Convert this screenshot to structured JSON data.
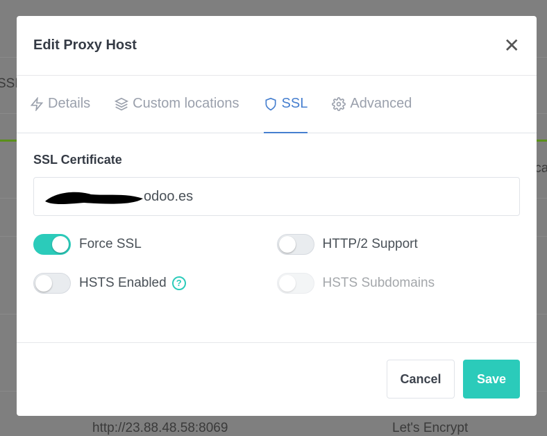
{
  "background": {
    "left_text": "SSL",
    "right_text": "lca",
    "bottom_url": "http://23.88.48.58:8069",
    "bottom_cert": "Let's Encrypt"
  },
  "modal": {
    "title": "Edit Proxy Host",
    "close_icon": "close-icon"
  },
  "tabs": [
    {
      "label": "Details",
      "icon": "bolt-icon"
    },
    {
      "label": "Custom locations",
      "icon": "layers-icon"
    },
    {
      "label": "SSL",
      "icon": "shield-icon",
      "active": true
    },
    {
      "label": "Advanced",
      "icon": "gear-icon"
    }
  ],
  "ssl": {
    "certificate_label": "SSL Certificate",
    "certificate_value": "odoo.es",
    "force_ssl": {
      "label": "Force SSL",
      "on": true
    },
    "http2": {
      "label": "HTTP/2 Support",
      "on": false
    },
    "hsts": {
      "label": "HSTS Enabled",
      "on": false,
      "help": "?"
    },
    "hsts_sub": {
      "label": "HSTS Subdomains",
      "on": false,
      "disabled": true
    }
  },
  "footer": {
    "cancel": "Cancel",
    "save": "Save"
  },
  "colors": {
    "accent": "#2bcbba",
    "tab_active": "#467fcf"
  }
}
